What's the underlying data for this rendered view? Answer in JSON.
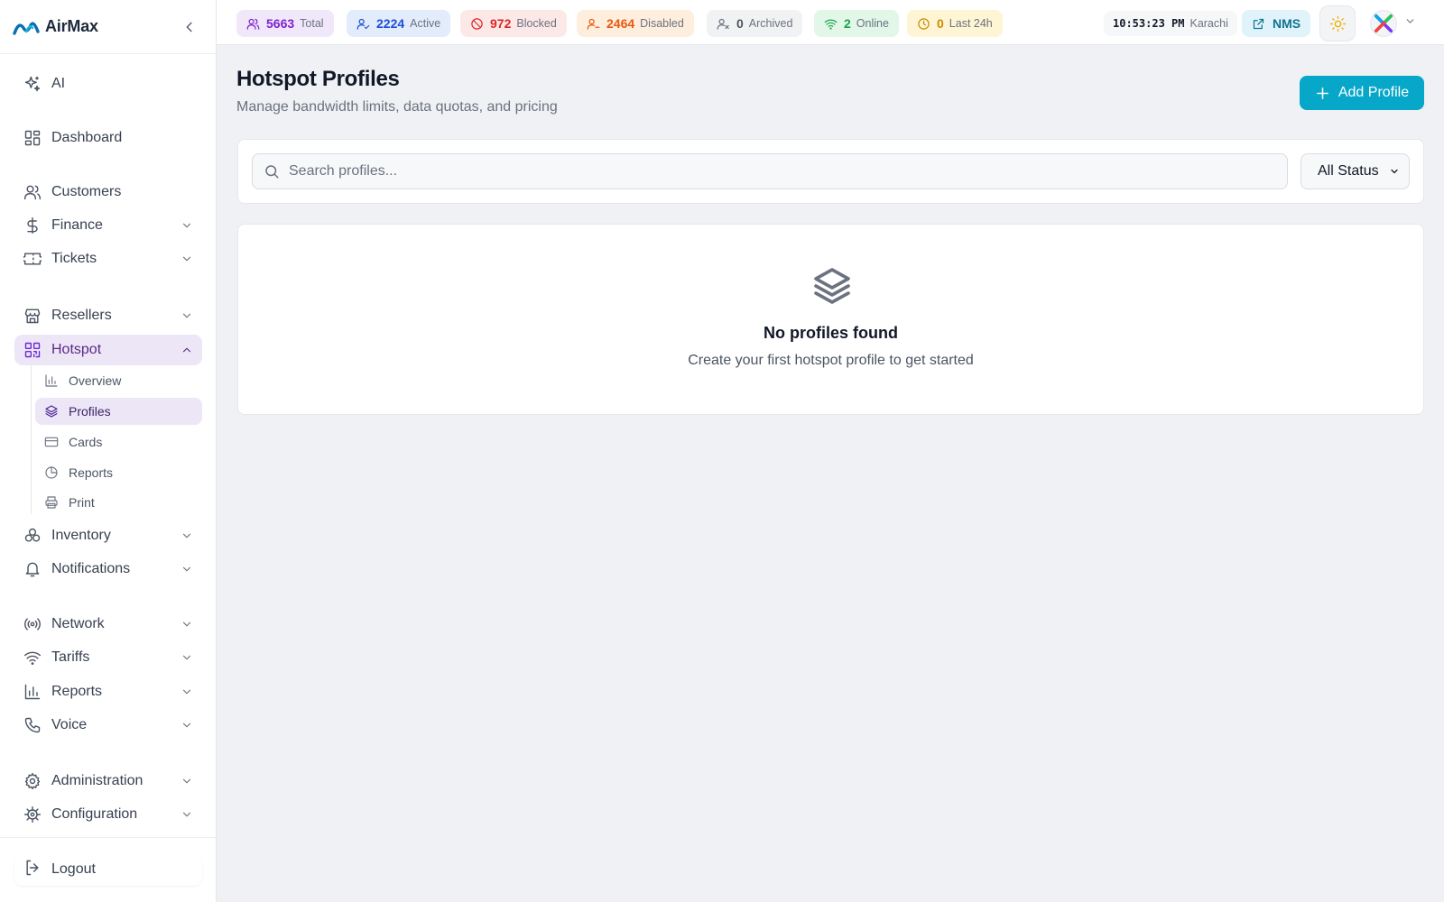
{
  "app": {
    "name": "AirMax"
  },
  "sidebar": {
    "items": [
      {
        "label": "AI",
        "icon": "sparkles-icon"
      },
      {
        "label": "Dashboard",
        "icon": "grid-icon"
      },
      {
        "label": "Customers",
        "icon": "users-icon"
      },
      {
        "label": "Finance",
        "icon": "dollar-icon"
      },
      {
        "label": "Tickets",
        "icon": "ticket-icon"
      },
      {
        "label": "Resellers",
        "icon": "store-icon"
      },
      {
        "label": "Hotspot",
        "icon": "qr-icon"
      },
      {
        "label": "Inventory",
        "icon": "boxes-icon"
      },
      {
        "label": "Notifications",
        "icon": "bell-icon"
      },
      {
        "label": "Network",
        "icon": "broadcast-icon"
      },
      {
        "label": "Tariffs",
        "icon": "wifi-icon"
      },
      {
        "label": "Reports",
        "icon": "bar-chart-icon"
      },
      {
        "label": "Voice",
        "icon": "phone-icon"
      },
      {
        "label": "Administration",
        "icon": "gear-icon"
      },
      {
        "label": "Configuration",
        "icon": "cog-icon"
      }
    ],
    "hotspot_sub": [
      {
        "label": "Overview",
        "icon": "bar-chart-icon"
      },
      {
        "label": "Profiles",
        "icon": "layers-icon"
      },
      {
        "label": "Cards",
        "icon": "card-icon"
      },
      {
        "label": "Reports",
        "icon": "pie-icon"
      },
      {
        "label": "Print",
        "icon": "printer-icon"
      }
    ],
    "logout": "Logout"
  },
  "topbar": {
    "stats": [
      {
        "value": "5663",
        "label": "Total",
        "color": "#7e22ce",
        "bg": "#f1e7fb"
      },
      {
        "value": "2224",
        "label": "Active",
        "color": "#1d4ed8",
        "bg": "#e3ecfb"
      },
      {
        "value": "972",
        "label": "Blocked",
        "color": "#dc2626",
        "bg": "#fde8e8"
      },
      {
        "value": "2464",
        "label": "Disabled",
        "color": "#ea580c",
        "bg": "#feeedd"
      },
      {
        "value": "0",
        "label": "Archived",
        "color": "#4b5563",
        "bg": "#f1f2f4"
      },
      {
        "value": "2",
        "label": "Online",
        "color": "#16a34a",
        "bg": "#e2f7e8"
      },
      {
        "value": "0",
        "label": "Last 24h",
        "color": "#ca8a04",
        "bg": "#fdf5d3"
      }
    ],
    "time": "10:53:23 PM",
    "timezone": "Karachi",
    "nms_label": "NMS"
  },
  "page": {
    "title": "Hotspot Profiles",
    "subtitle": "Manage bandwidth limits, data quotas, and pricing",
    "add_button": "Add Profile"
  },
  "filters": {
    "search_placeholder": "Search profiles...",
    "search_value": "",
    "status_selected": "All Status"
  },
  "empty_state": {
    "title": "No profiles found",
    "subtitle": "Create your first hotspot profile to get started"
  },
  "colors": {
    "accent": "#06a7c9",
    "active_nav_bg": "#ede6f7",
    "active_nav_text": "#5b2a86"
  }
}
